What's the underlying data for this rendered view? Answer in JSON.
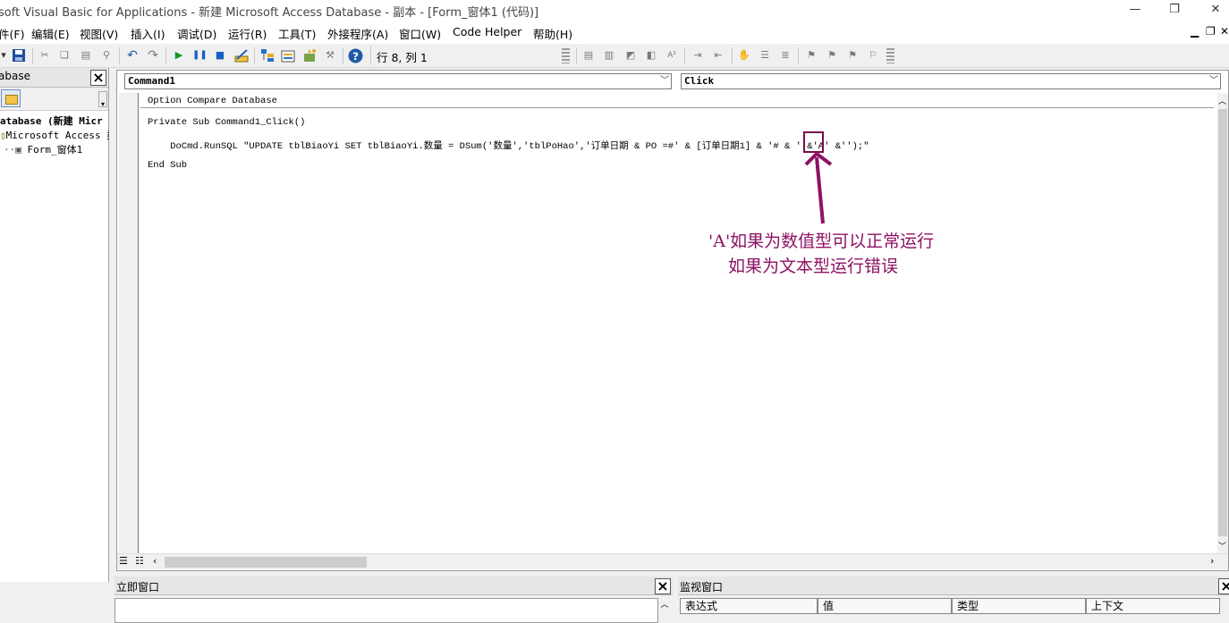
{
  "window": {
    "title": "soft Visual Basic for Applications - 新建 Microsoft Access Database - 副本 - [Form_窗体1 (代码)]",
    "minimize_glyph": "—",
    "restore_glyph": "❐",
    "close_glyph": "✕"
  },
  "menubar": {
    "items": [
      "件(F)",
      "编辑(E)",
      "视图(V)",
      "插入(I)",
      "调试(D)",
      "运行(R)",
      "工具(T)",
      "外接程序(A)",
      "窗口(W)",
      "Code Helper",
      "帮助(H)"
    ],
    "mdi_min": "▁",
    "mdi_restore": "❐",
    "mdi_close": "✕"
  },
  "toolbar": {
    "cursor_position": "行 8, 列 1",
    "icons": [
      "dropdown-icon",
      "save-icon",
      "cut-icon",
      "copy-icon",
      "paste-icon",
      "find-icon",
      "undo-icon",
      "redo-icon",
      "run-icon",
      "break-icon",
      "reset-icon",
      "design-mode-icon",
      "project-explorer-icon",
      "properties-icon",
      "object-browser-icon",
      "toolbox-icon",
      "help-icon"
    ],
    "edit_icons": [
      "list-properties-icon",
      "list-constants-icon",
      "quick-info-icon",
      "parameter-info-icon",
      "complete-word-icon",
      "indent-icon",
      "outdent-icon",
      "toggle-breakpoint-icon",
      "comment-block-icon",
      "uncomment-block-icon",
      "toggle-bookmark-icon",
      "next-bookmark-icon",
      "previous-bookmark-icon",
      "clear-bookmarks-icon"
    ]
  },
  "project_panel": {
    "title": "abase",
    "tree": [
      "atabase (新建 Micr",
      "Microsoft Access 类",
      "Form_窗体1"
    ]
  },
  "code_window": {
    "object_combo": "Command1",
    "procedure_combo": "Click",
    "lines": [
      "Option Compare Database",
      "Private Sub Command1_Click()",
      "    DoCmd.RunSQL \"UPDATE tblBiaoYi SET tblBiaoYi.数量 = DSum('数量','tblPoHao','订单日期 & PO =#' & [订单日期1] & '# & ' &'A' &'');\"",
      "End Sub"
    ]
  },
  "annotation": {
    "line1": "'A'如果为数值型可以正常运行",
    "line2": "如果为文本型运行错误",
    "color": "#8e1264"
  },
  "immediate_window": {
    "title": "立即窗口"
  },
  "watch_window": {
    "title": "监视窗口",
    "columns": [
      "表达式",
      "值",
      "类型",
      "上下文"
    ]
  }
}
